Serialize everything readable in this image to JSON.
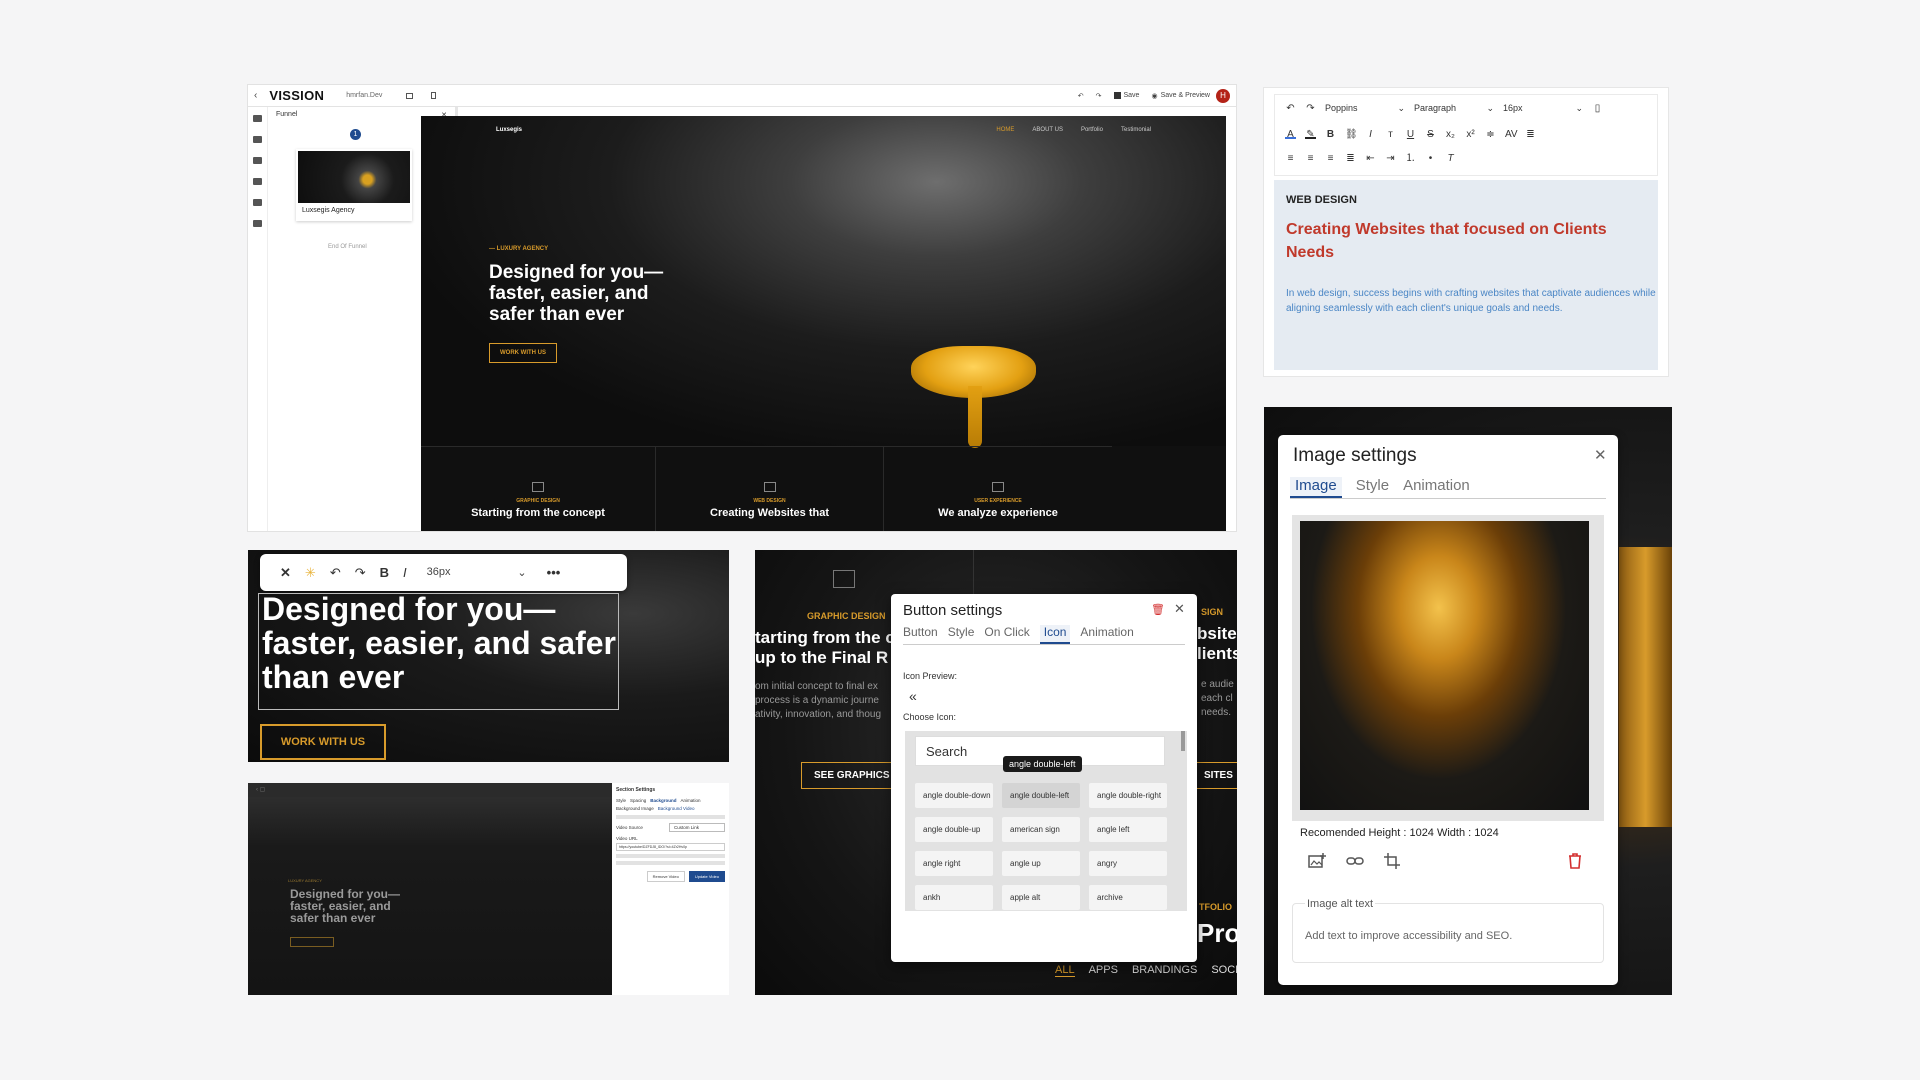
{
  "builder": {
    "logo": "VISSION",
    "domain": "hmrfan.Dev",
    "save_label": "Save",
    "save_preview_label": "Save & Preview",
    "avatar_initial": "H",
    "funnel": {
      "title": "Funnel",
      "step_number": "1",
      "page_name": "Luxsegis Agency",
      "end_label": "End Of Funnel"
    },
    "site": {
      "brand": "Luxsegis",
      "menu": [
        "HOME",
        "ABOUT US",
        "Portfolio",
        "Testimonial"
      ],
      "kicker": "— LUXURY AGENCY",
      "headline": "Designed for you— faster, easier, and safer than ever",
      "cta": "WORK WITH US",
      "features": [
        {
          "tag": "GRAPHIC DESIGN",
          "title": "Starting from the concept"
        },
        {
          "tag": "WEB DESIGN",
          "title": "Creating Websites that"
        },
        {
          "tag": "USER EXPERIENCE",
          "title": "We analyze experience"
        }
      ]
    }
  },
  "text_editor": {
    "font": "Poppins",
    "block": "Paragraph",
    "size": "16px",
    "category": "WEB DESIGN",
    "heading": "Creating Websites that focused on Clients Needs",
    "paragraph": "In web design, success begins with crafting websites that captivate audiences while aligning seamlessly with each client's unique goals and needs."
  },
  "inline_editor": {
    "font_size": "36px",
    "headline": "Designed for you— faster, easier, and safer than ever",
    "cta": "WORK WITH US"
  },
  "video_settings": {
    "panel_title": "Section Settings",
    "headline": "Designed for you— faster, easier, and safer than ever",
    "kicker": "LUXURY AGENCY",
    "tabs": [
      "Style",
      "Spacing",
      "Background",
      "Animation"
    ],
    "subtabs": [
      "Background Image",
      "Background Video"
    ],
    "video_source_label": "Video Source",
    "video_source_value": "Custom Link",
    "video_url_label": "Video URL",
    "video_url_value": "https://youtube/DZFDJ8_IDO/?si=4Zr2Hv0p",
    "remove_button": "Remove Video",
    "update_button": "Update Video"
  },
  "button_settings": {
    "title": "Button settings",
    "tabs": [
      "Button",
      "Style",
      "On Click",
      "Icon",
      "Animation"
    ],
    "active_tab": "Icon",
    "icon_preview_label": "Icon Preview:",
    "preview_glyph": "«",
    "choose_icon_label": "Choose Icon:",
    "search_placeholder": "Search",
    "tooltip": "angle double-left",
    "icons": [
      "angle double-down",
      "angle double-left",
      "angle double-right",
      "angle double-up",
      "american sign",
      "angle left",
      "angle right",
      "angle up",
      "angry",
      "ankh",
      "apple alt",
      "archive"
    ],
    "bg": {
      "left_tag": "GRAPHIC DESIGN",
      "left_title_1": "tarting from the c",
      "left_title_2": "up to the Final R",
      "left_text_1": "om initial concept to final ex",
      "left_text_2": "process is a dynamic journe",
      "left_text_3": "ativity, innovation, and thoug",
      "left_cta": "SEE GRAPHICS",
      "right_tag": "SIGN",
      "right_title_1": "bsite",
      "right_title_2": "lients",
      "right_text_1": "e audie",
      "right_text_2": "each cl",
      "right_text_3": "needs.",
      "right_cta": "SITES",
      "portfolio_tag": "TFOLIO",
      "portfolio_title": "Proj",
      "categories": [
        "ALL",
        "APPS",
        "BRANDINGS",
        "SOCIA"
      ]
    }
  },
  "image_settings": {
    "title": "Image settings",
    "tabs": [
      "Image",
      "Style",
      "Animation"
    ],
    "active_tab": "Image",
    "recommended": "Recomended Height : 1024 Width : 1024",
    "alt_label": "Image alt text",
    "alt_placeholder": "Add text to improve accessibility and SEO."
  },
  "colors": {
    "accent_gold": "#d89b2b",
    "primary_blue": "#1f4b8f",
    "heading_red": "#c0392b",
    "paragraph_blue": "#4a86c5",
    "delete_red": "#d32f2f"
  }
}
